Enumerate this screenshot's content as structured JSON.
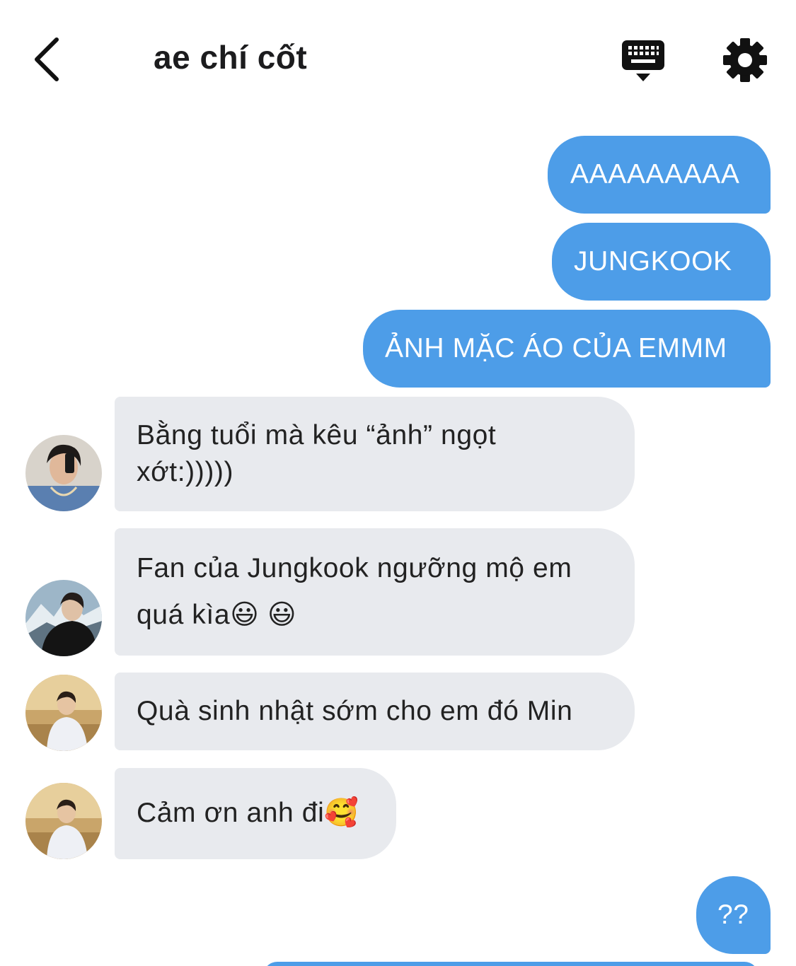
{
  "header": {
    "title": "ae chí cốt"
  },
  "messages": [
    {
      "text": "AAAAAAAAA"
    },
    {
      "text": "JUNGKOOK"
    },
    {
      "text": "ẢNH MẶC ÁO CỦA EMMM"
    },
    {
      "line1": "Bằng tuổi mà kêu “ảnh” ngọt",
      "line2": "xớt:)))))"
    },
    {
      "line1": "Fan của Jungkook ngưỡng mộ em",
      "line2": "quá kìa😃 😃"
    },
    {
      "text": "Quà sinh nhật sớm cho em đó Min"
    },
    {
      "text": "Cảm ơn anh đi🥰"
    },
    {
      "text": "??"
    }
  ],
  "colors": {
    "outgoing_bubble": "#4d9de8",
    "incoming_bubble": "#e8eaee"
  }
}
